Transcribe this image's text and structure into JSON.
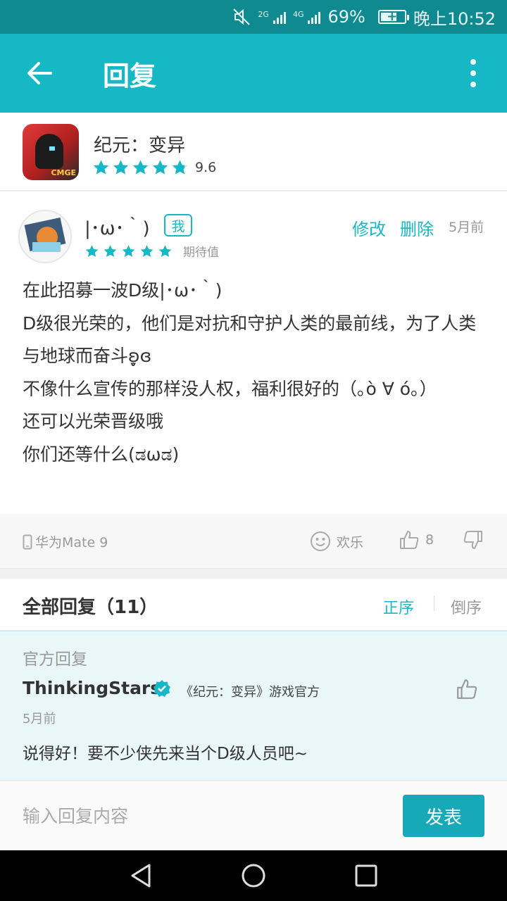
{
  "status_bar": {
    "network1": "2G",
    "network2": "4G",
    "battery_percent": "69%",
    "battery_level": 0.69,
    "time": "晚上10:52"
  },
  "app_bar": {
    "title": "回复",
    "back_icon": "arrow-left-icon",
    "more_icon": "more-vert-icon"
  },
  "game": {
    "name": "纪元：变异",
    "rating": 4.8,
    "score": "9.6",
    "icon_logo": "CMGE"
  },
  "review": {
    "user_name": "|･ω･｀)",
    "me_badge": "我",
    "edit_label": "修改",
    "delete_label": "删除",
    "time": "5月前",
    "stars": 5,
    "rating_label": "期待值",
    "lines": [
      "在此招募一波D级|･ω･｀)",
      "D级很光荣的，他们是对抗和守护人类的最前线，为了人类与地球而奋斗ʚ̥̬ɞ",
      "不像什么宣传的那样没人权，福利很好的（｡ò ∀ ó｡）",
      "还可以光荣晋级哦",
      "你们还等什么(ಡωಡ)"
    ],
    "device": "华为Mate 9",
    "mood_label": "欢乐",
    "like_count": "8"
  },
  "replies": {
    "title": "全部回复（11）",
    "sort_asc": "正序",
    "sort_desc": "倒序"
  },
  "official_reply": {
    "section_label": "官方回复",
    "name": "ThinkingStars",
    "tag": "《纪元：变异》游戏官方",
    "time": "5月前",
    "text": "说得好！要不少侠先来当个D级人员吧~"
  },
  "input": {
    "placeholder": "输入回复内容",
    "send_label": "发表"
  },
  "colors": {
    "accent": "#16b8c5",
    "status_bar": "#0f8a90",
    "official_bg": "#e9f7f9"
  }
}
